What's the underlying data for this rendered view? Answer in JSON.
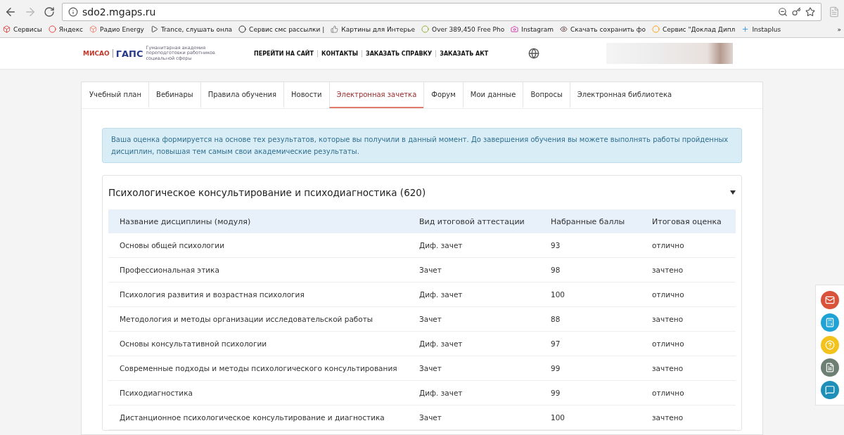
{
  "browser": {
    "url": "sdo2.mgaps.ru",
    "bookmarks": [
      {
        "label": "Сервисы"
      },
      {
        "label": "Яндекс"
      },
      {
        "label": "Радио Energy"
      },
      {
        "label": "Trance, слушать онла"
      },
      {
        "label": "Сервис смс рассылки |"
      },
      {
        "label": "Картины для Интерье"
      },
      {
        "label": "Over 389,450 Free Pho"
      },
      {
        "label": "Instagram"
      },
      {
        "label": "Скачать сохранить фо"
      },
      {
        "label": "Сервис \"Доклад Дипл"
      },
      {
        "label": "Instaplus"
      }
    ],
    "more": "»"
  },
  "header": {
    "logo_left": "МИСАО",
    "logo_main": "ГАПС",
    "logo_caption": "Гуманитарная академия переподготовки работников социальной сферы",
    "links": [
      "ПЕРЕЙТИ НА САЙТ",
      "КОНТАКТЫ",
      "ЗАКАЗАТЬ СПРАВКУ",
      "ЗАКАЗАТЬ АКТ"
    ]
  },
  "tabs": [
    {
      "label": "Учебный план",
      "selected": false
    },
    {
      "label": "Вебинары",
      "selected": false
    },
    {
      "label": "Правила обучения",
      "selected": false
    },
    {
      "label": "Новости",
      "selected": false
    },
    {
      "label": "Электронная зачетка",
      "selected": true
    },
    {
      "label": "Форум",
      "selected": false
    },
    {
      "label": "Мои данные",
      "selected": false
    },
    {
      "label": "Вопросы",
      "selected": false
    },
    {
      "label": "Электронная библиотека",
      "selected": false
    }
  ],
  "alert": "Ваша оценка формируется на основе тех результатов, которые вы получили в данный момент. До завершения обучения вы можете выполнять работы пройденных дисциплин, повышая тем самым свои академические результаты.",
  "program": {
    "title": "Психологическое консультирование и психодиагностика (620)",
    "expanded": true,
    "table": {
      "columns": [
        "Название дисциплины (модуля)",
        "Вид итоговой аттестации",
        "Набранные баллы",
        "Итоговая оценка"
      ],
      "rows": [
        [
          "Основы общей психологии",
          "Диф. зачет",
          "93",
          "отлично"
        ],
        [
          "Профессиональная этика",
          "Зачет",
          "98",
          "зачтено"
        ],
        [
          "Психология развития и возрастная психология",
          "Диф. зачет",
          "100",
          "отлично"
        ],
        [
          "Методология и методы организации исследовательской работы",
          "Зачет",
          "88",
          "зачтено"
        ],
        [
          "Основы консультативной психологии",
          "Диф. зачет",
          "97",
          "отлично"
        ],
        [
          "Современные подходы и методы психологического консультирования",
          "Зачет",
          "99",
          "зачтено"
        ],
        [
          "Психодиагностика",
          "Диф. зачет",
          "99",
          "отлично"
        ],
        [
          "Дистанционное психологическое консультирование и диагностика",
          "Зачет",
          "100",
          "зачтено"
        ]
      ]
    }
  }
}
